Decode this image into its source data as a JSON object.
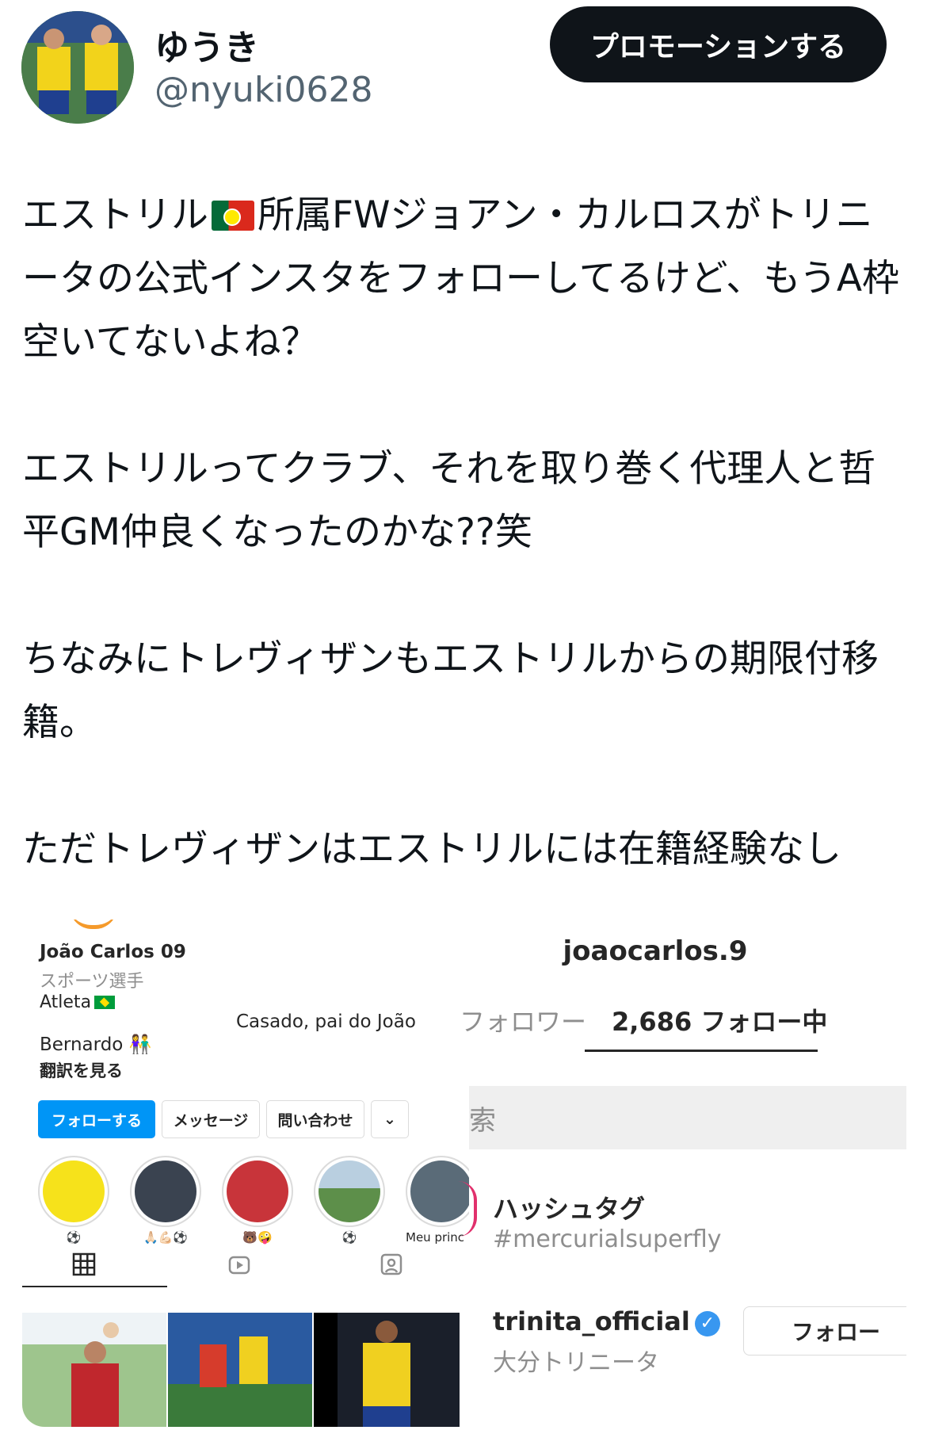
{
  "author": {
    "display_name": "ゆうき",
    "handle": "@nyuki0628"
  },
  "actions": {
    "promote_label": "プロモーションする"
  },
  "tweet": {
    "p1_before": "エストリル",
    "p1_after": "所属FWジョアン・カルロスがトリニータの公式インスタをフォローしてるけど、もうA枠空いてないよね？",
    "p2": "エストリルってクラブ、それを取り巻く代理人と哲平GM仲良くなったのかな??笑",
    "p3": "ちなみにトレヴィザンもエストリルからの期限付移籍。",
    "p4": "ただトレヴィザンはエストリルには在籍経験なし"
  },
  "left_screenshot": {
    "name": "João Carlos 09",
    "category": "スポーツ選手",
    "bio_line1": "Atleta",
    "bio_line2": "Casado, pai do João",
    "bio_line3": "Bernardo",
    "bio_emoji": "👫",
    "translate": "翻訳を見る",
    "buttons": {
      "follow": "フォローする",
      "message": "メッセージ",
      "contact": "問い合わせ",
      "more": "⌄"
    },
    "stories": [
      {
        "caption": "⚽"
      },
      {
        "caption": "🙏🏻💪🏻⚽"
      },
      {
        "caption": "🐻🤪"
      },
      {
        "caption": "⚽"
      },
      {
        "caption": "Meu princ"
      }
    ],
    "tabs": [
      "grid-icon",
      "reels-icon",
      "tagged-icon"
    ]
  },
  "right_screenshot": {
    "username": "joaocarlos.9",
    "tab_followers": "フォロワー",
    "tab_following": "2,686 フォロー中",
    "search_glyph": "索",
    "hashtag_title": "ハッシュタグ",
    "hashtag_value": "#mercurialsuperfly",
    "account_name": "trinita_official",
    "account_sub": "大分トリニータ",
    "follow_label": "フォロー"
  },
  "colors": {
    "ig_blue": "#0095f6",
    "promote_bg": "#0f1419",
    "secondary_text": "#536471"
  }
}
